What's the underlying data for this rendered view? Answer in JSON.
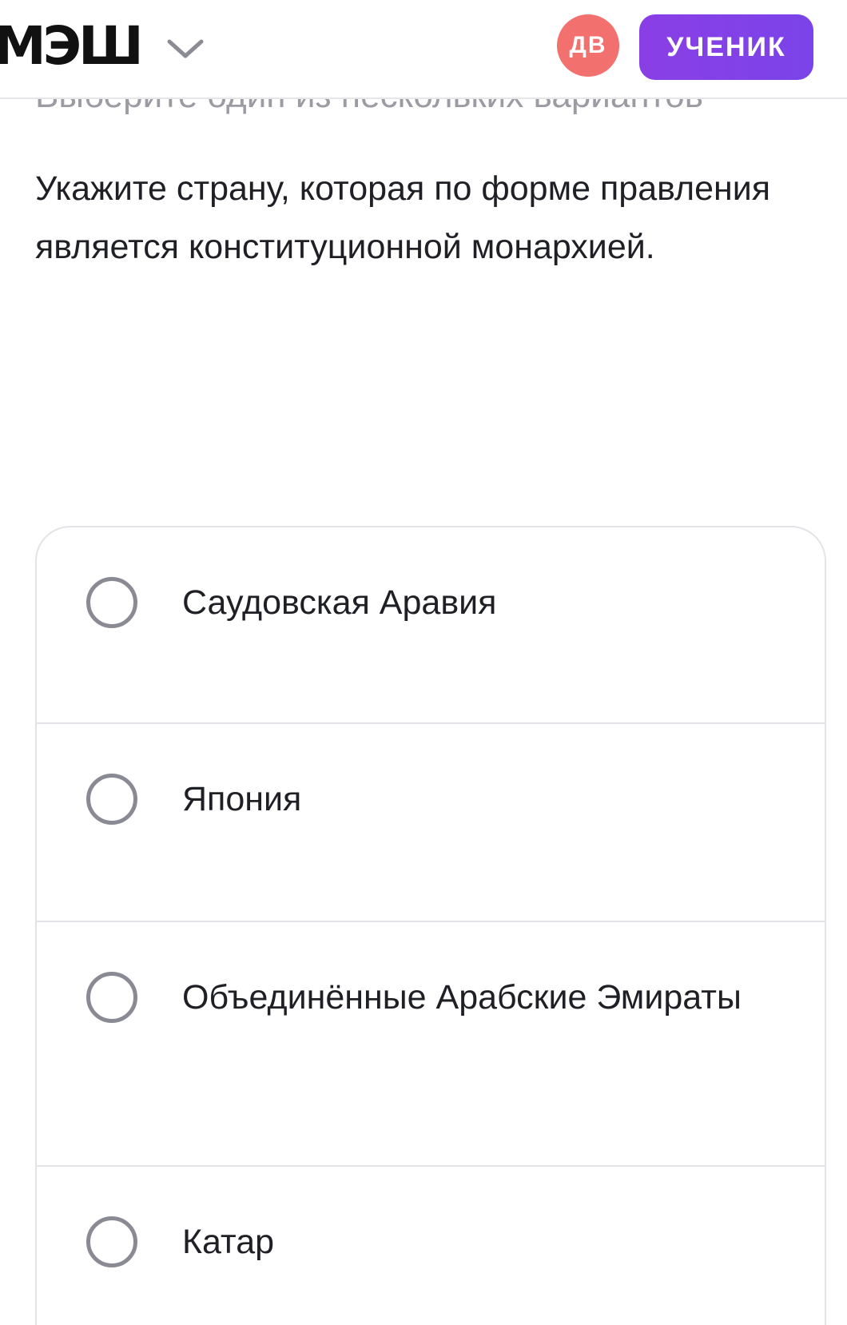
{
  "header": {
    "logo": "МЭШ",
    "avatar_initials": "ДВ",
    "role_label": "УЧЕНИК"
  },
  "task": {
    "hint": "Выберите один из нескольких вариантов",
    "question": "Укажите страну, которая по форме правления является конституционной монархией."
  },
  "options": [
    {
      "label": "Саудовская Аравия",
      "selected": false
    },
    {
      "label": "Япония",
      "selected": false
    },
    {
      "label": "Объединённые Арабские Эмираты",
      "selected": false
    },
    {
      "label": "Катар",
      "selected": false
    }
  ],
  "colors": {
    "accent": "#7b44e8",
    "avatar_bg": "#f2706e",
    "hint_text": "#9b9ba3",
    "radio_border": "#8a8a95"
  },
  "icons": {
    "dropdown": "chevron-down-icon",
    "option_marker": "radio-circle-icon"
  }
}
